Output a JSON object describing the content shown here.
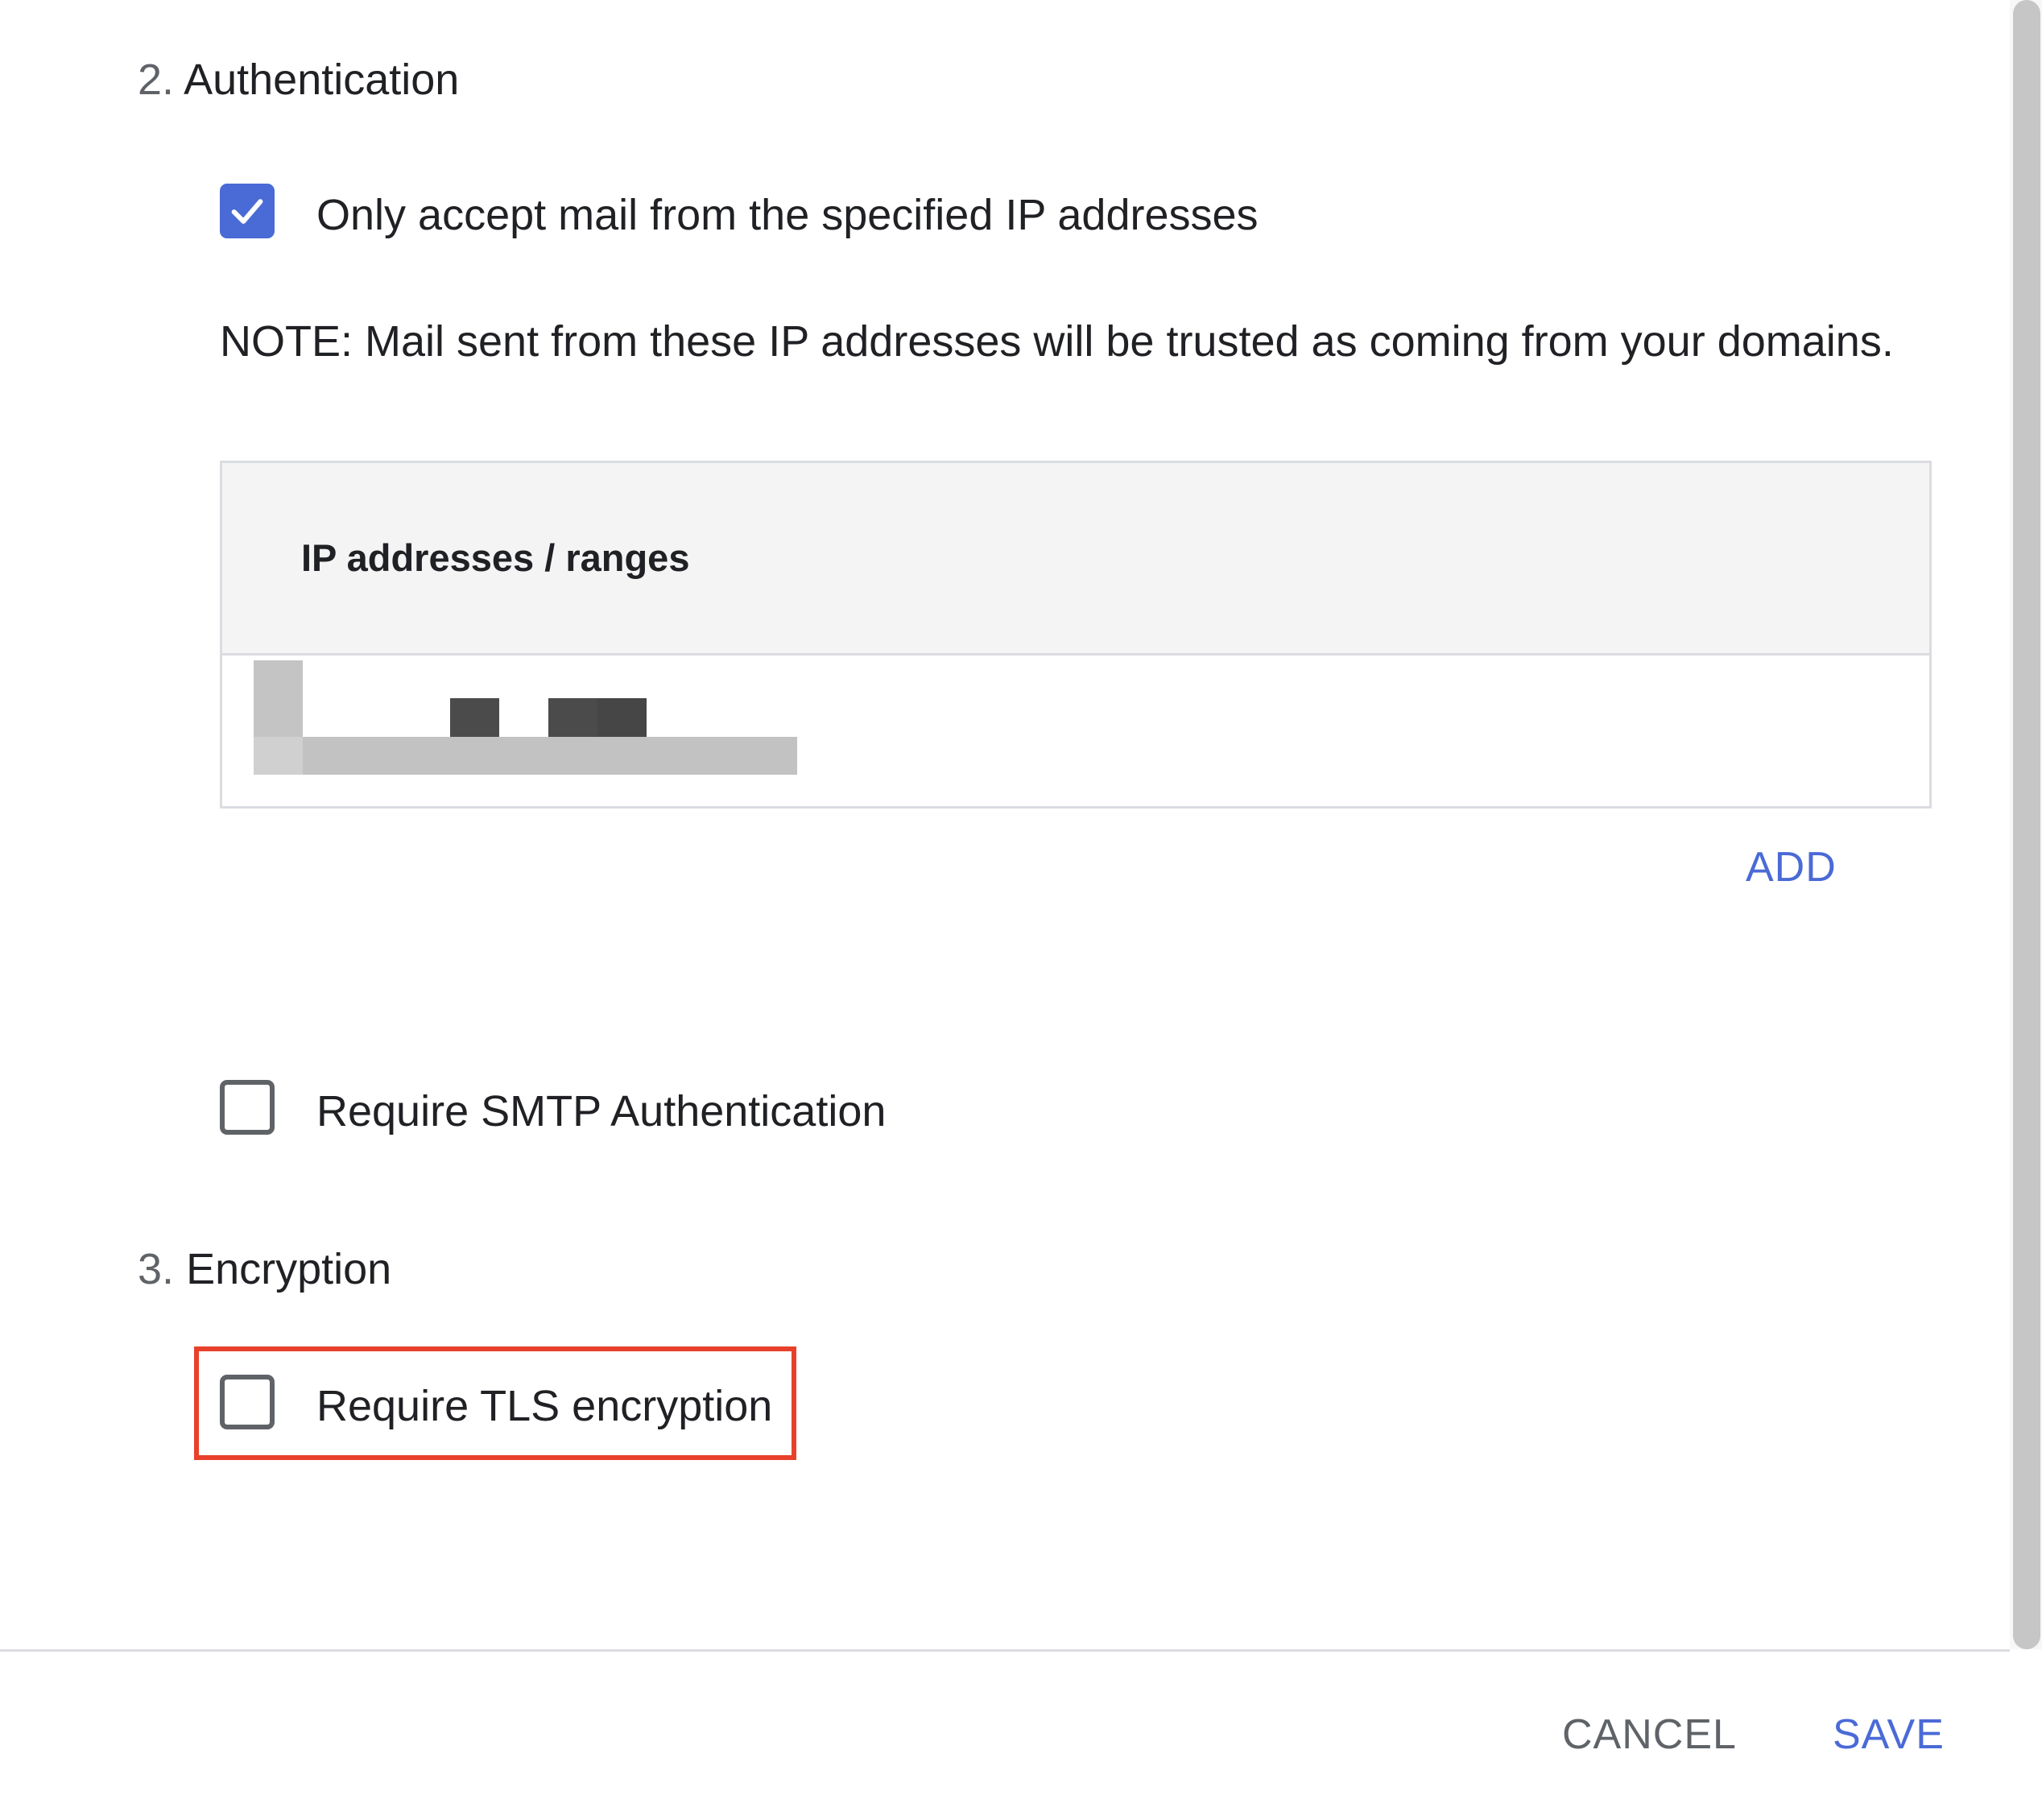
{
  "authentication": {
    "number": "2.",
    "title": "Authentication",
    "ip_only": {
      "label": "Only accept mail from the specified IP addresses",
      "checked": true
    },
    "note": "NOTE: Mail sent from these IP addresses will be trusted as coming from your domains.",
    "table": {
      "header": "IP addresses / ranges"
    },
    "add_label": "ADD",
    "smtp_auth": {
      "label": "Require SMTP Authentication",
      "checked": false
    }
  },
  "encryption": {
    "number": "3.",
    "title": "Encryption",
    "tls": {
      "label": "Require TLS encryption",
      "checked": false
    }
  },
  "footer": {
    "cancel_label": "CANCEL",
    "save_label": "SAVE"
  },
  "colors": {
    "accent": "#4a6ad6",
    "highlight": "#e8402b",
    "muted": "#5f6368"
  },
  "icons": {
    "checked": "checkmark-icon"
  }
}
